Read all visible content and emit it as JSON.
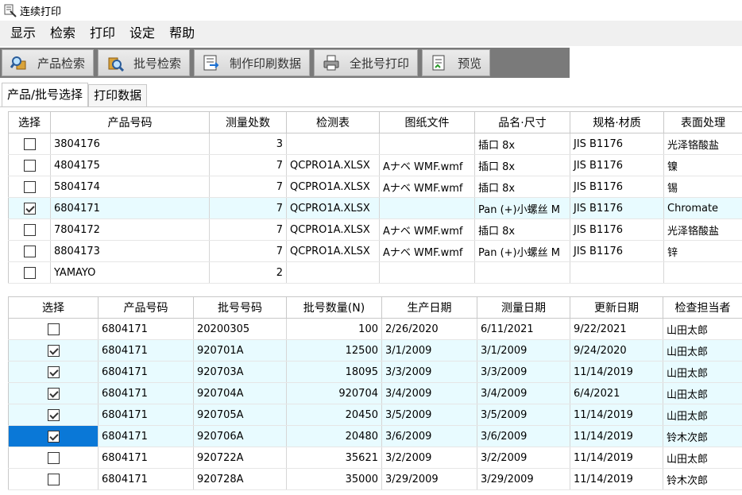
{
  "window": {
    "title": "连续打印",
    "icon": "printer-doc-icon"
  },
  "menu": [
    "显示",
    "检索",
    "打印",
    "设定",
    "帮助"
  ],
  "toolbar": [
    {
      "label": "产品检索",
      "icon": "magnify-product-icon"
    },
    {
      "label": "批号检索",
      "icon": "magnify-lot-icon"
    },
    {
      "label": "制作印刷数据",
      "icon": "export-data-icon"
    },
    {
      "label": "全批号打印",
      "icon": "printer-icon"
    },
    {
      "label": "预览",
      "icon": "preview-doc-icon"
    }
  ],
  "tabs": [
    "产品/批号选择",
    "打印数据"
  ],
  "product_table": {
    "headers": [
      "选择",
      "产品号码",
      "测量处数",
      "检测表",
      "图纸文件",
      "品名·尺寸",
      "规格·材质",
      "表面处理"
    ],
    "rows": [
      {
        "checked": false,
        "product": "3804176",
        "count": "3",
        "sheet": "",
        "drawing": "",
        "name": "插口 8x",
        "spec": "JIS B1176",
        "finish": "光泽铬酸盐"
      },
      {
        "checked": false,
        "product": "4804175",
        "count": "7",
        "sheet": "QCPRO1A.XLSX",
        "drawing": "Aナベ WMF.wmf",
        "name": "插口 8x",
        "spec": "JIS B1176",
        "finish": "镍"
      },
      {
        "checked": false,
        "product": "5804174",
        "count": "7",
        "sheet": "QCPRO1A.XLSX",
        "drawing": "Aナベ WMF.wmf",
        "name": "插口 8x",
        "spec": "JIS B1176",
        "finish": "锡"
      },
      {
        "checked": true,
        "product": "6804171",
        "count": "7",
        "sheet": "QCPRO1A.XLSX",
        "drawing": "",
        "name": "Pan (+)小螺丝 M",
        "spec": "JIS B1176",
        "finish": "Chromate"
      },
      {
        "checked": false,
        "product": "7804172",
        "count": "7",
        "sheet": "QCPRO1A.XLSX",
        "drawing": "Aナベ WMF.wmf",
        "name": "插口 8x",
        "spec": "JIS B1176",
        "finish": "光泽铬酸盐"
      },
      {
        "checked": false,
        "product": "8804173",
        "count": "7",
        "sheet": "QCPRO1A.XLSX",
        "drawing": "Aナベ WMF.wmf",
        "name": "Pan (+)小螺丝 M",
        "spec": "JIS B1176",
        "finish": "锌"
      },
      {
        "checked": false,
        "product": "YAMAYO",
        "count": "2",
        "sheet": "",
        "drawing": "",
        "name": "",
        "spec": "",
        "finish": ""
      }
    ]
  },
  "lot_table": {
    "headers": [
      "选择",
      "产品号码",
      "批号号码",
      "批号数量(N)",
      "生产日期",
      "测量日期",
      "更新日期",
      "检查担当者"
    ],
    "rows": [
      {
        "checked": false,
        "product": "6804171",
        "lot": "20200305",
        "qty": "100",
        "made": "2/26/2020",
        "measured": "6/11/2021",
        "updated": "9/22/2021",
        "inspector": "山田太郎"
      },
      {
        "checked": true,
        "product": "6804171",
        "lot": "920701A",
        "qty": "12500",
        "made": "3/1/2009",
        "measured": "3/1/2009",
        "updated": "9/24/2020",
        "inspector": "山田太郎"
      },
      {
        "checked": true,
        "product": "6804171",
        "lot": "920703A",
        "qty": "18095",
        "made": "3/3/2009",
        "measured": "3/3/2009",
        "updated": "11/14/2019",
        "inspector": "山田太郎"
      },
      {
        "checked": true,
        "product": "6804171",
        "lot": "920704A",
        "qty": "920704",
        "made": "3/4/2009",
        "measured": "3/4/2009",
        "updated": "6/4/2021",
        "inspector": "山田太郎"
      },
      {
        "checked": true,
        "product": "6804171",
        "lot": "920705A",
        "qty": "20450",
        "made": "3/5/2009",
        "measured": "3/5/2009",
        "updated": "11/14/2019",
        "inspector": "山田太郎"
      },
      {
        "checked": true,
        "product": "6804171",
        "lot": "920706A",
        "qty": "20480",
        "made": "3/6/2009",
        "measured": "3/6/2009",
        "updated": "11/14/2019",
        "inspector": "铃木次郎"
      },
      {
        "checked": false,
        "product": "6804171",
        "lot": "920722A",
        "qty": "35621",
        "made": "3/2/2009",
        "measured": "3/2/2009",
        "updated": "11/14/2019",
        "inspector": "山田太郎"
      },
      {
        "checked": false,
        "product": "6804171",
        "lot": "920728A",
        "qty": "35000",
        "made": "3/29/2009",
        "measured": "3/29/2009",
        "updated": "11/14/2019",
        "inspector": "铃木次郎"
      }
    ]
  },
  "colors": {
    "selected_row": "#e8fbff",
    "current_cell": "#0a78d7",
    "toolbar_bg": "#7a7a7a"
  }
}
